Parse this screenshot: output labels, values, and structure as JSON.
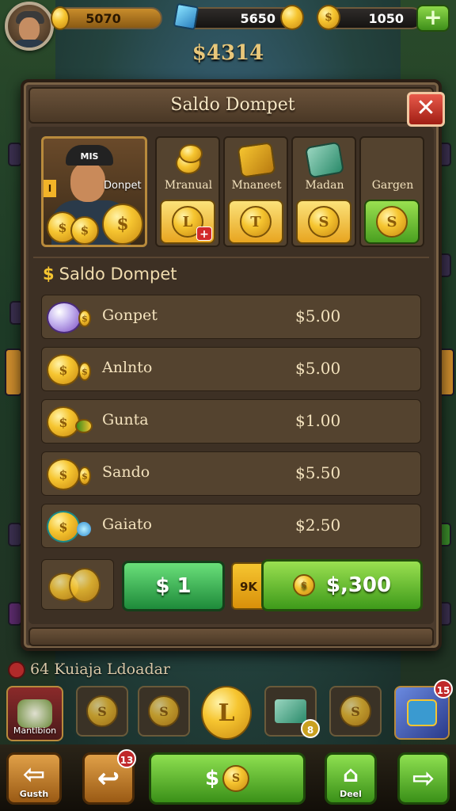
{
  "hud": {
    "xp_value": "5070",
    "gems_value": "5650",
    "coins_value": "1050",
    "total_balance": "$4314"
  },
  "panel": {
    "title": "Saldo Dompet",
    "close_glyph": "✕",
    "hero": {
      "cap_text": "MIS",
      "label": "Donpet",
      "tag": "I"
    },
    "options": [
      {
        "label": "Mranual",
        "button_icon": "coin-icon",
        "badge": "+"
      },
      {
        "label": "Mnaneet",
        "button_icon": "coin-icon"
      },
      {
        "label": "Madan",
        "button_icon": "coin-icon"
      },
      {
        "label": "Gargen",
        "button_icon": "coin-icon"
      }
    ],
    "section_title": "Saldo Dompet",
    "section_glyph": "$",
    "rows": [
      {
        "name": "Gonpet",
        "value": "$5.00"
      },
      {
        "name": "Anlnto",
        "value": "$5.00"
      },
      {
        "name": "Gunta",
        "value": "$1.00"
      },
      {
        "name": "Sando",
        "value": "$5.50"
      },
      {
        "name": "Gaiato",
        "value": "$2.50"
      }
    ],
    "buy_small_label": "$ 1",
    "buy_tab_label": "9K",
    "buy_large_label": "$,300"
  },
  "quest": {
    "text": "64 Kuiaja Ldoadar"
  },
  "slots": {
    "first_label": "Mantlbion",
    "right_badge": "15",
    "middle_badge": "8"
  },
  "dock": {
    "back_label": "Gusth",
    "undo_badge": "13",
    "main_label": "$",
    "gift_label": "Deel"
  },
  "colors": {
    "gold": "#f6c530",
    "green": "#4aa020",
    "panel_brown": "#4a3a2c",
    "close_red": "#d02a1a"
  }
}
